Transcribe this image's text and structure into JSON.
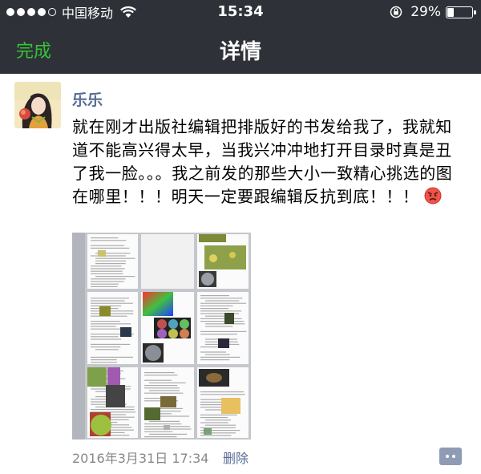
{
  "status_bar": {
    "carrier": "中国移动",
    "time": "15:34",
    "battery": "29%",
    "battery_level": 0.29,
    "icons": [
      "signal-dots-icon",
      "wifi-icon",
      "rotation-lock-icon",
      "battery-icon"
    ]
  },
  "nav": {
    "done_label": "完成",
    "title": "详情"
  },
  "post": {
    "author": "乐乐",
    "text": "就在刚才出版社编辑把排版好的书发给我了，我就知道不能高兴得太早，当我兴冲冲地打开目录时真是丑了我一脸。。。我之前发的那些大小一致精心挑选的图在哪里！！！明天一定要跟编辑反抗到底！！！",
    "emoji": "angry-face-icon",
    "timestamp": "2016年3月31日 17:34",
    "delete_label": "删除",
    "comment_icon": "comment-more-icon"
  },
  "colors": {
    "bar_background": "#2e3238",
    "done_green": "#36c136",
    "link_blue": "#576b95",
    "timestamp_gray": "#888888",
    "comment_button": "#8f9bb5"
  }
}
